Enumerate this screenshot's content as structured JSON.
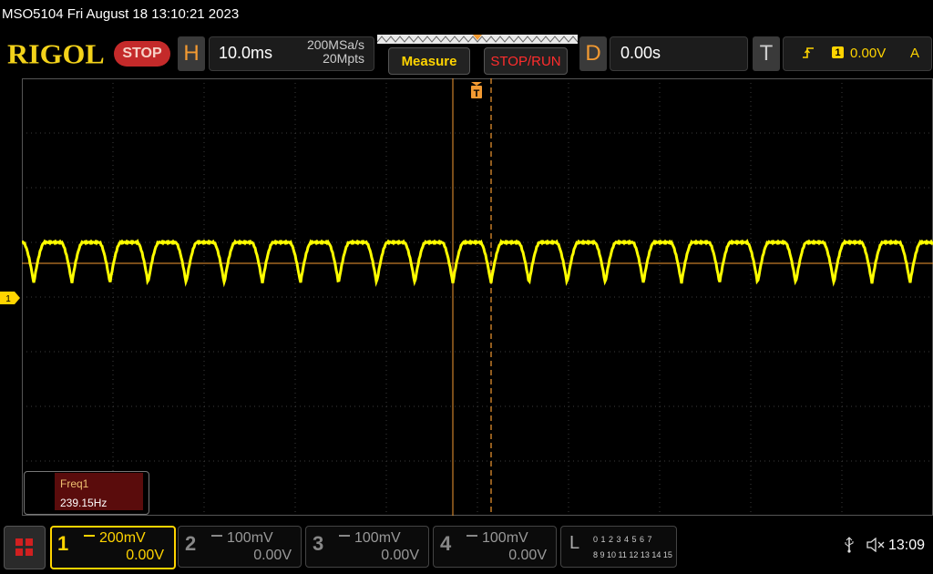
{
  "titlebar": {
    "text": "MSO5104  Fri August 18 13:10:21 2023"
  },
  "header": {
    "logo": "RIGOL",
    "run_state": "STOP",
    "horizontal": {
      "letter": "H",
      "timebase": "10.0ms",
      "sample_rate": "200MSa/s",
      "memory_depth": "20Mpts"
    },
    "measure_label": "Measure",
    "stoprun_label": "STOP/RUN",
    "delay": {
      "letter": "D",
      "value": "0.00s"
    },
    "trigger": {
      "letter": "T",
      "edge_icon": "rising-edge-icon",
      "source": "1",
      "level": "0.00V",
      "mode": "A"
    }
  },
  "screen": {
    "ch1_marker": "1",
    "trigger_marker": "T",
    "grid_divisions": {
      "horizontal": 10,
      "vertical": 8
    },
    "trace": {
      "channel": "1",
      "color": "#ffff00",
      "waveform_frequency_hz": 239.15,
      "timebase_per_div_ms": 10.0,
      "volts_per_div_mv": 200,
      "high_level_div": 0.45,
      "low_level_div": -0.35
    },
    "cursor_color": "#f39a32"
  },
  "measurement": {
    "name": "Freq1",
    "value": "239.15Hz"
  },
  "channels": [
    {
      "num": "1",
      "scale": "200mV",
      "offset": "0.00V",
      "color": "#ffd400",
      "active": true
    },
    {
      "num": "2",
      "scale": "100mV",
      "offset": "0.00V",
      "color": "#888888",
      "active": false
    },
    {
      "num": "3",
      "scale": "100mV",
      "offset": "0.00V",
      "color": "#888888",
      "active": false
    },
    {
      "num": "4",
      "scale": "100mV",
      "offset": "0.00V",
      "color": "#888888",
      "active": false
    }
  ],
  "logic": {
    "letter": "L",
    "row1": "0 1 2 3   4 5 6 7",
    "row2": "8 9 10 11 12 13 14 15"
  },
  "status": {
    "usb_icon": "usb-icon",
    "mute_icon": "speaker-mute-icon",
    "time": "13:09"
  }
}
